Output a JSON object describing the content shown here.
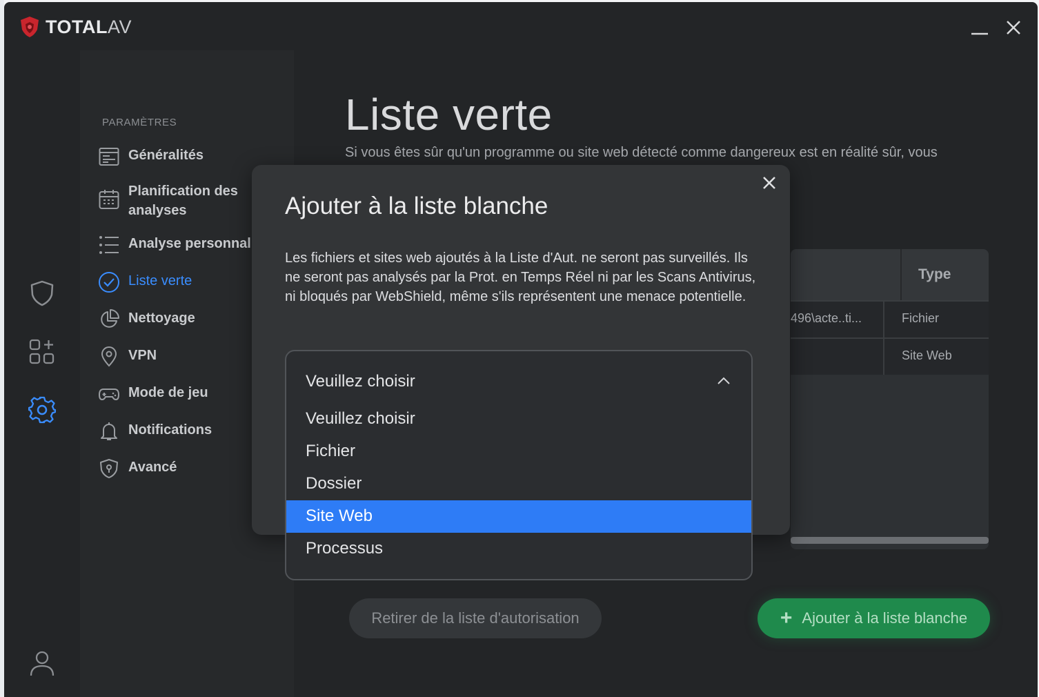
{
  "app": {
    "logo_bold": "TOTAL",
    "logo_light": "AV"
  },
  "sidebar": {
    "header": "PARAMÈTRES",
    "items": [
      {
        "label": "Généralités"
      },
      {
        "label": "Planification des analyses"
      },
      {
        "label": "Analyse personnalisée"
      },
      {
        "label": "Liste verte"
      },
      {
        "label": "Nettoyage"
      },
      {
        "label": "VPN"
      },
      {
        "label": "Mode de jeu"
      },
      {
        "label": "Notifications"
      },
      {
        "label": "Avancé"
      }
    ]
  },
  "main": {
    "title": "Liste verte",
    "description": "Si vous êtes sûr qu'un programme ou site web détecté comme dangereux est en réalité sûr, vous pouvez l'ajouter à la liste d'autorisation pour ne plus bloquer",
    "table": {
      "type_header": "Type",
      "rows": [
        {
          "path": "496\\acte..ti...",
          "type": "Fichier"
        },
        {
          "path": "",
          "type": "Site Web"
        }
      ]
    },
    "remove_button": "Retirer de la liste d'autorisation",
    "add_button": "Ajouter à la liste blanche"
  },
  "modal": {
    "title": "Ajouter à la liste blanche",
    "body": "Les fichiers et sites web ajoutés à la Liste d'Aut. ne seront pas surveillés. Ils ne seront pas analysés par la Prot. en Temps Réel ni par les Scans Antivirus, ni bloqués par WebShield, même s'ils représentent une menace potentielle.",
    "dropdown": {
      "selected": "Veuillez choisir",
      "options": [
        "Veuillez choisir",
        "Fichier",
        "Dossier",
        "Site Web",
        "Processus"
      ],
      "highlighted": "Site Web"
    }
  },
  "colors": {
    "accent": "#3a8dff",
    "highlight": "#2e7cf6",
    "green": "#1f8a4c",
    "bg": "#232527"
  }
}
